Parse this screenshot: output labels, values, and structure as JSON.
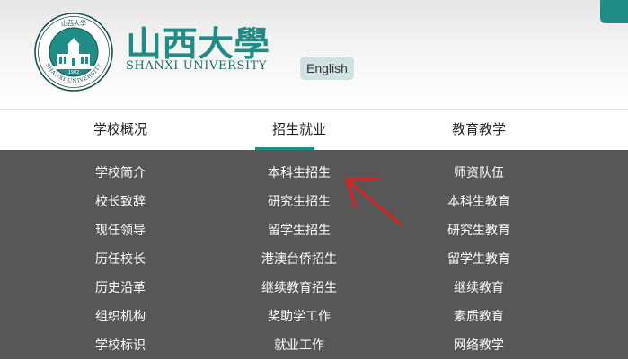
{
  "header": {
    "brand_cn": "山西大學",
    "brand_en": "SHANXI UNIVERSITY",
    "seal_text_top": "山西大學",
    "seal_text_ring": "SHANXI UNIVERSITY",
    "seal_year": "1902",
    "language_button": "English"
  },
  "nav": {
    "tabs": [
      {
        "label": "学校概况",
        "active": false
      },
      {
        "label": "招生就业",
        "active": true
      },
      {
        "label": "教育教学",
        "active": false
      }
    ]
  },
  "dropdown": {
    "columns": [
      [
        "学校简介",
        "校长致辞",
        "现任领导",
        "历任校长",
        "历史沿革",
        "组织机构",
        "学校标识"
      ],
      [
        "本科生招生",
        "研究生招生",
        "留学生招生",
        "港澳台侨招生",
        "继续教育招生",
        "奖助学工作",
        "就业工作"
      ],
      [
        "师资队伍",
        "本科生教育",
        "研究生教育",
        "留学生教育",
        "继续教育",
        "素质教育",
        "网络教学"
      ]
    ]
  },
  "annotation": {
    "arrow_color": "#e02020"
  },
  "colors": {
    "accent": "#1f8c86",
    "dropdown_bg": "#575757",
    "lang_bg": "#cfe1e0"
  }
}
